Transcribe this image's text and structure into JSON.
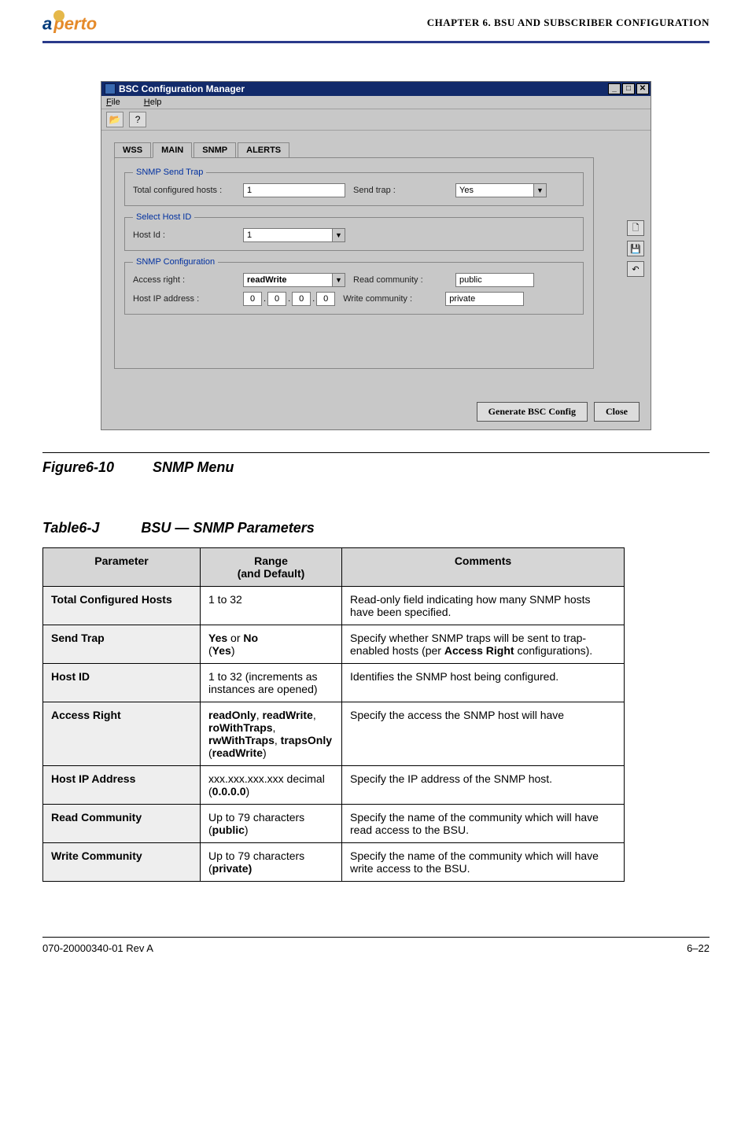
{
  "header": {
    "logo_left": "a",
    "logo_right": "perto",
    "chapter": "CHAPTER 6.  BSU AND SUBSCRIBER CONFIGURATION"
  },
  "window": {
    "title": "BSC Configuration Manager",
    "menu_file": "File",
    "menu_help": "Help",
    "tabs": [
      "WSS",
      "MAIN",
      "SNMP",
      "ALERTS"
    ],
    "active_tab": "MAIN",
    "grp_send_trap": "SNMP Send Trap",
    "grp_select_host": "Select Host ID",
    "grp_config": "SNMP Configuration",
    "lbl_total_hosts": "Total configured hosts :",
    "val_total_hosts": "1",
    "lbl_send_trap": "Send trap :",
    "val_send_trap": "Yes",
    "lbl_host_id": "Host Id :",
    "val_host_id": "1",
    "lbl_access_right": "Access right :",
    "val_access_right": "readWrite",
    "lbl_read_comm": "Read community :",
    "val_read_comm": "public",
    "lbl_host_ip": "Host IP address :",
    "val_ip": [
      "0",
      "0",
      "0",
      "0"
    ],
    "lbl_write_comm": "Write community :",
    "val_write_comm": "private",
    "btn_generate": "Generate BSC Config",
    "btn_close": "Close"
  },
  "figure": {
    "num": "Figure6-10",
    "title": "SNMP Menu"
  },
  "table_caption": {
    "num": "Table6-J",
    "title": "BSU — SNMP Parameters"
  },
  "table": {
    "headers": [
      "Parameter",
      "Range\n(and Default)",
      "Comments"
    ],
    "rows": [
      {
        "param": "Total Configured Hosts",
        "range": "1 to 32",
        "comment": "Read-only field indicating how many SNMP hosts have been specified."
      },
      {
        "param": "Send Trap",
        "range_html": "<span class='b'>Yes</span> or <span class='b'>No</span><br>(<span class='b'>Yes</span>)",
        "comment_html": "Specify whether SNMP traps will be sent to trap-enabled hosts (per <span class='b'>Access Right</span> configurations)."
      },
      {
        "param": "Host ID",
        "range": "1 to 32 (increments as instances are opened)",
        "comment": "Identifies the SNMP host being configured."
      },
      {
        "param": "Access Right",
        "range_html": "<span class='b'>readOnly</span>, <span class='b'>readWrite</span>, <span class='b'>roWithTraps</span>, <span class='b'>rwWithTraps</span>, <span class='b'>trapsOnly</span><br>(<span class='b'>readWrite</span>)",
        "comment": "Specify the access the SNMP host will have"
      },
      {
        "param": "Host IP Address",
        "range_html": "xxx.xxx.xxx.xxx decimal<br>(<span class='b'>0.0.0.0</span>)",
        "comment": "Specify the IP address of the SNMP host."
      },
      {
        "param": "Read Community",
        "range_html": "Up to 79 characters<br>(<span class='b'>public</span>)",
        "comment": "Specify the name of the community which will have read access to the BSU."
      },
      {
        "param": "Write Community",
        "range_html": "Up to 79 characters<br>(<span class='b'>private)</span>",
        "comment": "Specify the name of the community which will have write access to the BSU."
      }
    ]
  },
  "footer": {
    "left": "070-20000340-01 Rev A",
    "right": "6–22"
  }
}
